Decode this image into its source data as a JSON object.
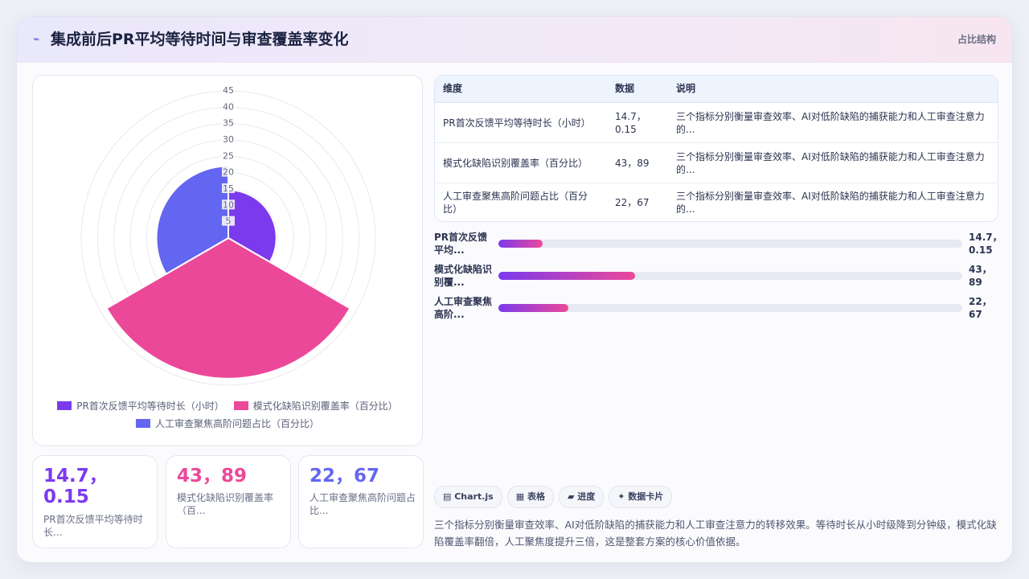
{
  "header": {
    "icon": "sparkline-icon",
    "title": "集成前后PR平均等待时间与审查覆盖率变化",
    "tag": "占比结构"
  },
  "chart_data": {
    "type": "polarArea",
    "title": "",
    "rlim": [
      0,
      45
    ],
    "ticks": [
      "5",
      "10",
      "15",
      "20",
      "25",
      "30",
      "35",
      "40",
      "45"
    ],
    "categories": [
      "PR首次反馈平均等待时长（小时）",
      "模式化缺陷识别覆盖率（百分比）",
      "人工审查聚焦高阶问题占比（百分比）"
    ],
    "values": [
      14.7,
      43,
      22
    ],
    "colors": [
      "#7c3aed",
      "#ec4899",
      "#6366f1"
    ],
    "grid": true,
    "legend": "bottom"
  },
  "legend": [
    {
      "label": "PR首次反馈平均等待时长（小时）",
      "color": "#7c3aed"
    },
    {
      "label": "模式化缺陷识别覆盖率（百分比）",
      "color": "#ec4899"
    },
    {
      "label": "人工审查聚焦高阶问题占比（百分比）",
      "color": "#6366f1"
    }
  ],
  "kpis": [
    {
      "value": "14.7，0.15",
      "label": "PR首次反馈平均等待时长...",
      "color": "#7c3aed"
    },
    {
      "value": "43，89",
      "label": "模式化缺陷识别覆盖率（百...",
      "color": "#ec4899"
    },
    {
      "value": "22，67",
      "label": "人工审查聚焦高阶问题占比...",
      "color": "#6366f1"
    }
  ],
  "table": {
    "headers": [
      "维度",
      "数据",
      "说明"
    ],
    "rows": [
      [
        "PR首次反馈平均等待时长（小时）",
        "14.7，0.15",
        "三个指标分别衡量审查效率、AI对低阶缺陷的捕获能力和人工审查注意力的..."
      ],
      [
        "模式化缺陷识别覆盖率（百分比）",
        "43，89",
        "三个指标分别衡量审查效率、AI对低阶缺陷的捕获能力和人工审查注意力的..."
      ],
      [
        "人工审查聚焦高阶问题占比（百分比）",
        "22，67",
        "三个指标分别衡量审查效率、AI对低阶缺陷的捕获能力和人工审查注意力的..."
      ]
    ]
  },
  "bars": [
    {
      "label": "PR首次反馈平均...",
      "value": "14.7，0.15",
      "fraction": 0.095
    },
    {
      "label": "模式化缺陷识别覆...",
      "value": "43，89",
      "fraction": 0.295
    },
    {
      "label": "人工审查聚焦高阶...",
      "value": "22，67",
      "fraction": 0.15
    }
  ],
  "chips": [
    "▤ Chart.js",
    "▦ 表格",
    "▰ 进度",
    "✦ 数据卡片"
  ],
  "summary": "三个指标分别衡量审查效率、AI对低阶缺陷的捕获能力和人工审查注意力的转移效果。等待时长从小时级降到分钟级，模式化缺陷覆盖率翻倍，人工聚焦度提升三倍，这是整套方案的核心价值依据。"
}
